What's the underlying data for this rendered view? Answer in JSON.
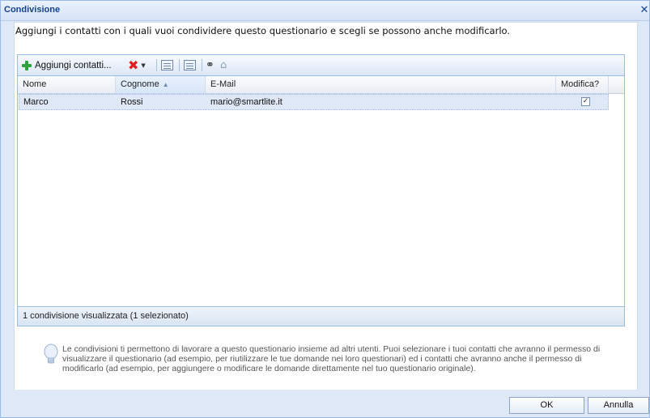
{
  "window": {
    "title": "Condivisione",
    "close_glyph": "✕"
  },
  "intro": "Aggiungi i contatti con i quali vuoi condividere questo questionario e scegli se possono anche modificarlo.",
  "toolbar": {
    "add_label": "Aggiungi contatti...",
    "icons": [
      "add-icon",
      "delete-icon",
      "dropdown-arrow-icon",
      "select-all-icon",
      "details-icon",
      "binoculars-icon",
      "home-icon"
    ]
  },
  "grid": {
    "columns": [
      "Nome",
      "Cognome",
      "E-Mail",
      "Modifica?"
    ],
    "sort_column": "Cognome",
    "rows": [
      {
        "nome": "Marco",
        "cognome": "Rossi",
        "email": "mario@smartlite.it",
        "modifica": true
      }
    ],
    "status": "1 condivisione visualizzata (1 selezionato)"
  },
  "info": "Le condivisioni ti permettono di lavorare a questo questionario insieme ad altri utenti. Puoi selezionare i tuoi contatti che avranno il permesso di visualizzare il questionario (ad esempio, per riutilizzare le tue domande nei loro questionari) ed i contatti che avranno anche il permesso di modificarlo (ad esempio, per aggiungere o modificare le domande direttamente nel tuo questionario originale).",
  "buttons": {
    "ok": "OK",
    "cancel": "Annulla"
  },
  "colors": {
    "title": "#15428b",
    "selected_row": "#dfe8f6",
    "window_bg": "#dfe8f6"
  }
}
